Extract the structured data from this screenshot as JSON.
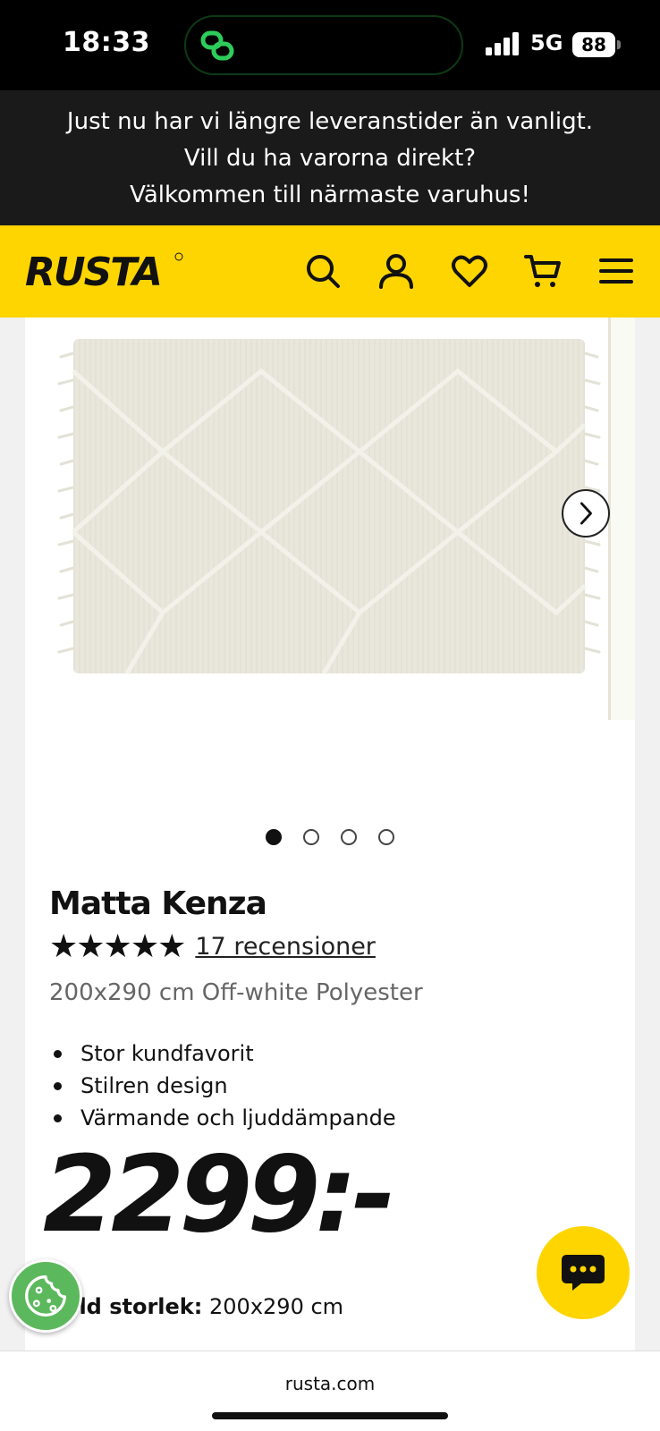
{
  "status_bar": {
    "time": "18:33",
    "network": "5G",
    "battery": "88"
  },
  "notice": {
    "lines": [
      "Just nu har vi längre leveranstider än vanligt.",
      "Vill du ha varorna direkt?",
      "Välkommen till närmaste varuhus!"
    ]
  },
  "header": {
    "logo": "RUSTA",
    "icons": [
      "search-icon",
      "account-icon",
      "heart-icon",
      "cart-icon",
      "menu-icon"
    ],
    "brand_color": "#ffd500"
  },
  "gallery": {
    "image_count": 4,
    "active_index": 0
  },
  "product": {
    "title": "Matta Kenza",
    "stars": "★★★★★",
    "rating": 5,
    "reviews": "17 recensioner",
    "subtitle": "200x290 cm Off-white Polyester",
    "bullets": [
      "Stor kundfavorit",
      "Stilren design",
      "Värmande och ljuddämpande"
    ],
    "price": "2299:-",
    "size_label": "Vald storlek:",
    "size_value": "200x290 cm"
  },
  "browser": {
    "url": "rusta.com"
  }
}
